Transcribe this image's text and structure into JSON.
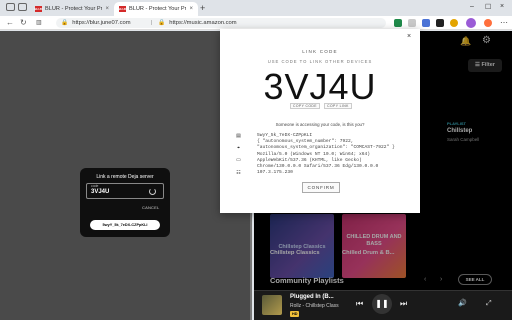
{
  "browser": {
    "tabs": [
      {
        "label": "BLUR - Protect Your Privacy Acro",
        "favicon": "BLUR"
      },
      {
        "label": "BLUR - Protect Your Privacy Acro",
        "favicon": "BLUR"
      }
    ],
    "url_left": "https://blur.june07.com",
    "url_right": "https://music.amazon.com"
  },
  "left_panel": {
    "title": "Link a remote Deja server",
    "code_label": "code",
    "code_value": "3VJ4U",
    "cancel_label": "CANCEL",
    "device_label": "5wyY_5k_7eDX-CZPpKLI"
  },
  "modal": {
    "title": "LINK CODE",
    "subtitle": "USE CODE TO LINK OTHER DEVICES",
    "code": "3VJ4U",
    "copy_code_label": "COPY CODE",
    "copy_link_label": "COPY LINK",
    "warning": "Someone is accessing your code, is this you?",
    "device_id": "5wyY_5k_7eDX-CZPpKLI",
    "network": "{ \"autonomous_system_number\": 7922, \"autonomous_system_organization\": \"COMCAST-7922\" }",
    "user_agent": "Mozilla/5.0 (Windows NT 10.0; Win64; x64) AppleWebKit/537.36 (KHTML, like Gecko) Chrome/130.0.0.0 Safari/537.36 Edg/130.0.0.0",
    "ip": "107.3.175.230",
    "confirm_label": "CONFIRM"
  },
  "music": {
    "filter_label": "Filter",
    "playlist_tag": "PLAYLIST",
    "playlist_name": "Chillstep",
    "playlist_artist": "Sarah Campbell",
    "cards": [
      {
        "label": "Chillstep Classics",
        "art_text": "Chillstep Classics"
      },
      {
        "label": "Chilled Drum & B...",
        "art_text": "CHILLED DRUM AND BASS"
      }
    ],
    "section_title": "Community Playlists",
    "see_all_label": "SEE ALL",
    "player": {
      "title": "Plugged In (B...",
      "subtitle": "Rollz - Chillstep Class",
      "badge": "HD"
    }
  }
}
